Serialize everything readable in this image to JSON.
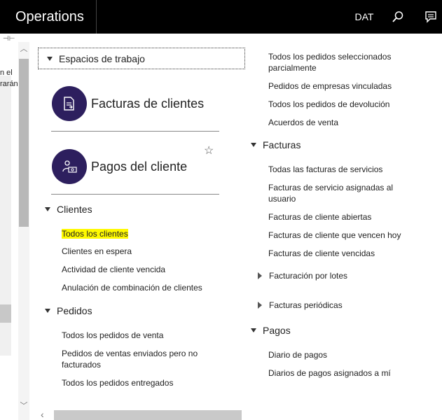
{
  "topbar": {
    "app_title": "Operations",
    "company": "DAT",
    "search_icon": "search-icon",
    "feedback_icon": "feedback-icon"
  },
  "background": {
    "line1": "n el",
    "line2": "rarán"
  },
  "workspaces": {
    "header": "Espacios de trabajo",
    "tiles": [
      {
        "name": "Facturas de clientes",
        "icon": "invoice-icon"
      },
      {
        "name": "Pagos del cliente",
        "icon": "payment-icon"
      }
    ]
  },
  "clientes": {
    "header": "Clientes",
    "items": [
      "Todos los clientes",
      "Clientes en espera",
      "Actividad de cliente vencida",
      "Anulación de combinación de clientes"
    ]
  },
  "pedidos": {
    "header": "Pedidos",
    "items": [
      "Todos los pedidos de venta",
      "Pedidos de ventas enviados pero no facturados",
      "Todos los pedidos entregados"
    ]
  },
  "right_orders": {
    "items": [
      "Todos los pedidos seleccionados parcialmente",
      "Pedidos de empresas vinculadas",
      "Todos los pedidos de devolución",
      "Acuerdos de venta"
    ]
  },
  "facturas": {
    "header": "Facturas",
    "items": [
      "Todas las facturas de servicios",
      "Facturas de servicio asignadas al usuario",
      "Facturas de cliente abiertas",
      "Facturas de cliente que vencen hoy",
      "Facturas de cliente vencidas"
    ],
    "collapsed": [
      "Facturación por lotes",
      "Facturas periódicas"
    ]
  },
  "pagos": {
    "header": "Pagos",
    "items": [
      "Diario de pagos",
      "Diarios de pagos asignados a mí"
    ]
  },
  "colors": {
    "accent": "#2d1f5e",
    "highlight": "#fffa00",
    "topbar": "#000000"
  }
}
